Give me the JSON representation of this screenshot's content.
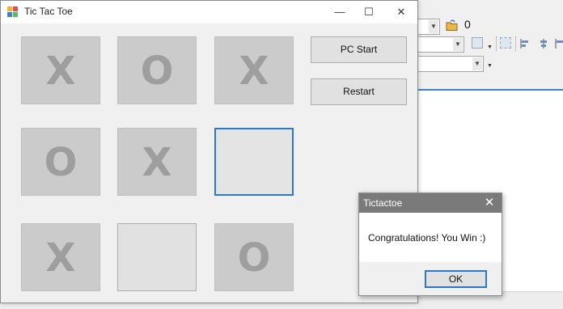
{
  "window": {
    "title": "Tic Tac Toe",
    "controls": {
      "minimize": "—",
      "maximize": "☐",
      "close": "✕"
    }
  },
  "board": {
    "cells": [
      "X",
      "O",
      "X",
      "O",
      "X",
      "",
      "X",
      "",
      "O"
    ],
    "focused_cell": 5
  },
  "buttons": {
    "pc_start": "PC Start",
    "restart": "Restart"
  },
  "message_box": {
    "title": "Tictactoe",
    "close": "✕",
    "text": "Congratulations! You Win :)",
    "ok": "OK"
  },
  "background_ide": {
    "value_field": "0",
    "accent_color": "#3c7fd3"
  },
  "colors": {
    "focus_border": "#2b79c5",
    "cell_fill": "#cbcbcb",
    "mark_color": "#9e9e9e"
  }
}
